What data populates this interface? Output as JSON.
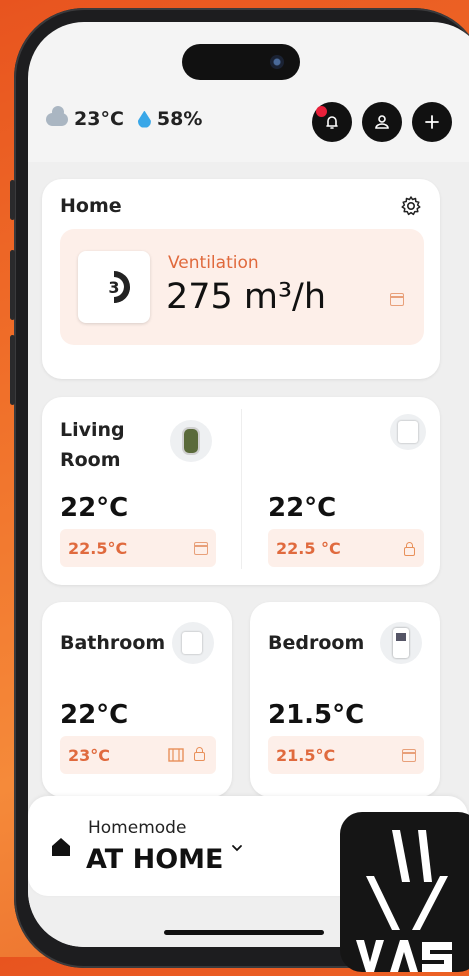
{
  "status": {
    "temp": "23°C",
    "humidity": "58%"
  },
  "home": {
    "title": "Home",
    "vent_label": "Ventilation",
    "vent_value": "275 m³/h"
  },
  "living": {
    "title_line1": "Living",
    "title_line2": "Room",
    "temp_left": "22°C",
    "set_left": "22.5°C",
    "temp_right": "22°C",
    "set_right": "22.5 °C"
  },
  "bathroom": {
    "title": "Bathroom",
    "temp": "22°C",
    "set": "23°C"
  },
  "bedroom": {
    "title": "Bedroom",
    "temp": "21.5°C",
    "set": "21.5°C"
  },
  "mode": {
    "label": "Homemode",
    "value": "AT HOME"
  },
  "colors": {
    "accent": "#e0693c",
    "pill_bg": "#fdefe9",
    "button_dark": "#111111",
    "alert": "#e8203a"
  }
}
